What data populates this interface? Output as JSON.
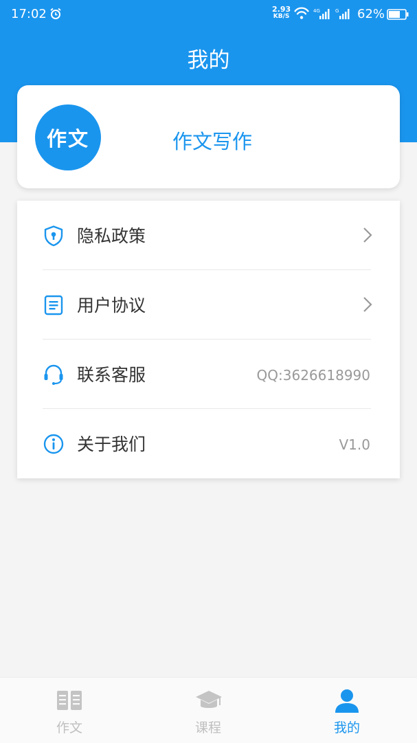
{
  "status_bar": {
    "time": "17:02",
    "net_speed_value": "2.93",
    "net_speed_unit": "KB/S",
    "battery": "62%"
  },
  "header": {
    "title": "我的"
  },
  "profile": {
    "avatar_text": "作文",
    "app_name": "作文写作"
  },
  "menu": {
    "items": [
      {
        "label": "隐私政策",
        "icon": "shield-icon",
        "value": ""
      },
      {
        "label": "用户协议",
        "icon": "document-icon",
        "value": ""
      },
      {
        "label": "联系客服",
        "icon": "headset-icon",
        "value": "QQ:3626618990"
      },
      {
        "label": "关于我们",
        "icon": "info-icon",
        "value": "V1.0"
      }
    ]
  },
  "tabs": [
    {
      "label": "作文",
      "icon": "book-icon",
      "active": false
    },
    {
      "label": "课程",
      "icon": "graduation-cap-icon",
      "active": false
    },
    {
      "label": "我的",
      "icon": "person-icon",
      "active": true
    }
  ],
  "colors": {
    "accent": "#1a95ee",
    "tab_inactive": "#bfbfbf",
    "text_primary": "#333333",
    "text_secondary": "#999999",
    "background": "#f4f4f4"
  }
}
